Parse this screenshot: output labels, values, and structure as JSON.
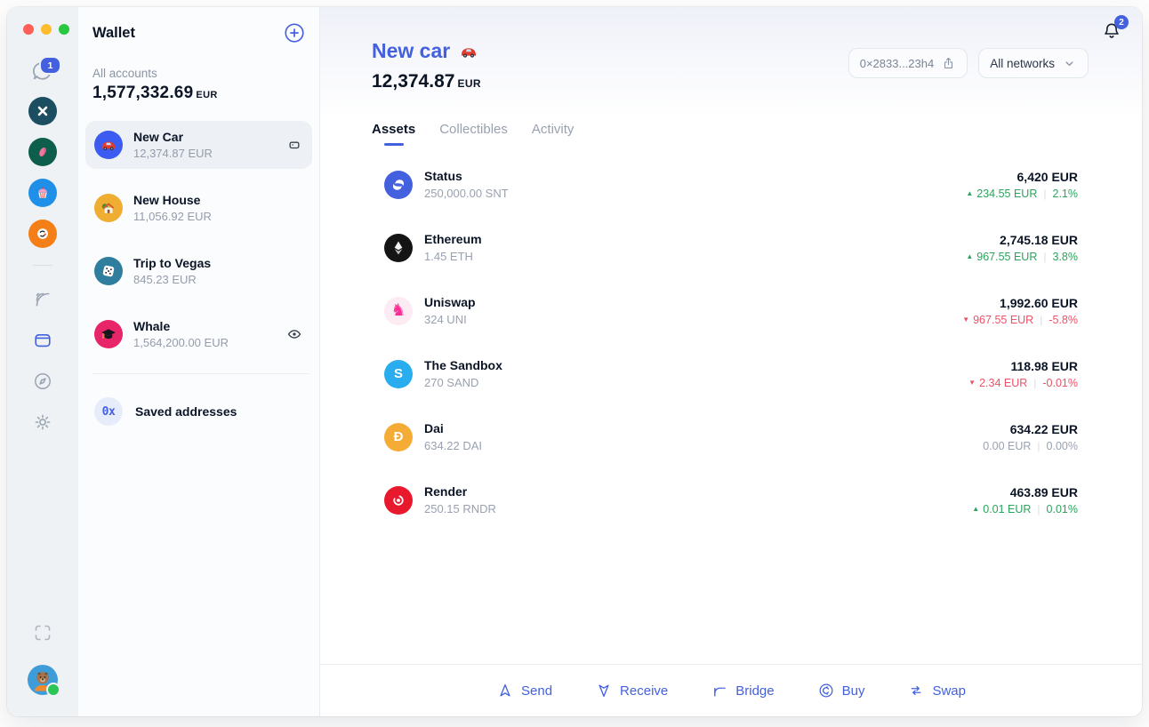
{
  "colors": {
    "accent": "#4360DF",
    "positive": "#2BA35D",
    "negative": "#EA5268",
    "neutral": "#99A1B0"
  },
  "rail": {
    "messages_badge": "1",
    "communities": [
      {
        "name": "x-community",
        "icon": "x-logo",
        "color": "#1C4E61"
      },
      {
        "name": "petal-community",
        "icon": "petal",
        "color": "#0D5F4C"
      },
      {
        "name": "cupcake-community",
        "icon": "cupcake",
        "color": "#1F8FE8"
      },
      {
        "name": "doodle-community",
        "icon": "doodle",
        "color": "#F57F17"
      }
    ]
  },
  "sidebar": {
    "title": "Wallet",
    "all_accounts_label": "All accounts",
    "total_value": "1,577,332.69",
    "total_currency": "EUR",
    "accounts": [
      {
        "name": "New Car",
        "balance": "12,374.87 EUR",
        "icon": "car",
        "color": "#3C5BF0",
        "selected": true,
        "trailing": "card"
      },
      {
        "name": "New House",
        "balance": "11,056.92 EUR",
        "icon": "house",
        "color": "#EFAE32"
      },
      {
        "name": "Trip to Vegas",
        "balance": "845.23 EUR",
        "icon": "dice",
        "color": "#2F7E9E"
      },
      {
        "name": "Whale",
        "balance": "1,564,200.00 EUR",
        "icon": "grad",
        "color": "#E72568",
        "trailing": "eye"
      }
    ],
    "saved_addresses_label": "Saved addresses",
    "saved_addresses_glyph": "0x"
  },
  "header": {
    "account_name": "New car",
    "balance": "12,374.87",
    "currency": "EUR",
    "address_chip": "0×2833...23h4",
    "network_selector": "All networks",
    "notification_count": "2"
  },
  "tabs": [
    {
      "label": "Assets",
      "active": true
    },
    {
      "label": "Collectibles",
      "active": false
    },
    {
      "label": "Activity",
      "active": false
    }
  ],
  "assets": [
    {
      "name": "Status",
      "amount": "250,000.00 SNT",
      "value": "6,420 EUR",
      "change": "234.55 EUR",
      "percent": "2.1%",
      "direction": "up",
      "icon": "status",
      "color": "#4360DF"
    },
    {
      "name": "Ethereum",
      "amount": "1.45 ETH",
      "value": "2,745.18 EUR",
      "change": "967.55 EUR",
      "percent": "3.8%",
      "direction": "up",
      "icon": "eth",
      "color": "#141414"
    },
    {
      "name": "Uniswap",
      "amount": "324 UNI",
      "value": "1,992.60 EUR",
      "change": "967.55 EUR",
      "percent": "-5.8%",
      "direction": "down",
      "icon": "uniswap",
      "color": "#FDEBF4",
      "fg": "#FF2D95"
    },
    {
      "name": "The Sandbox",
      "amount": "270 SAND",
      "value": "118.98 EUR",
      "change": "2.34 EUR",
      "percent": "-0.01%",
      "direction": "down",
      "icon": "sandbox",
      "color": "#29ADEF"
    },
    {
      "name": "Dai",
      "amount": "634.22 DAI",
      "value": "634.22 EUR",
      "change": "0.00 EUR",
      "percent": "0.00%",
      "direction": "flat",
      "icon": "dai",
      "color": "#F5AC37"
    },
    {
      "name": "Render",
      "amount": "250.15 RNDR",
      "value": "463.89 EUR",
      "change": "0.01 EUR",
      "percent": "0.01%",
      "direction": "up",
      "icon": "render",
      "color": "#E8192C"
    }
  ],
  "footer": {
    "actions": [
      {
        "label": "Send",
        "icon": "send"
      },
      {
        "label": "Receive",
        "icon": "receive"
      },
      {
        "label": "Bridge",
        "icon": "bridge"
      },
      {
        "label": "Buy",
        "icon": "buy"
      },
      {
        "label": "Swap",
        "icon": "swap"
      }
    ]
  }
}
